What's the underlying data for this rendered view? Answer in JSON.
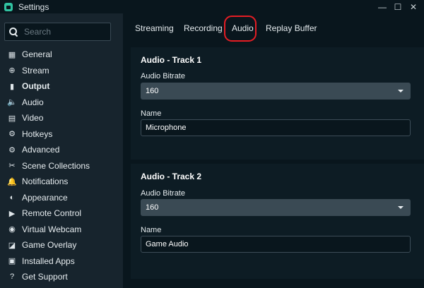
{
  "window": {
    "title": "Settings",
    "minimize": "—",
    "maximize": "☐",
    "close": "✕"
  },
  "search": {
    "placeholder": "Search",
    "value": ""
  },
  "sidebar": {
    "items": [
      {
        "label": "General",
        "icon": "grid-icon",
        "glyph": "▦"
      },
      {
        "label": "Stream",
        "icon": "globe-icon",
        "glyph": "⊕"
      },
      {
        "label": "Output",
        "icon": "output-icon",
        "glyph": "▮",
        "active": true
      },
      {
        "label": "Audio",
        "icon": "speaker-icon",
        "glyph": "🔈"
      },
      {
        "label": "Video",
        "icon": "film-icon",
        "glyph": "▤"
      },
      {
        "label": "Hotkeys",
        "icon": "gear-icon",
        "glyph": "⚙"
      },
      {
        "label": "Advanced",
        "icon": "gears-icon",
        "glyph": "⚙"
      },
      {
        "label": "Scene Collections",
        "icon": "tools-icon",
        "glyph": "✂"
      },
      {
        "label": "Notifications",
        "icon": "bell-icon",
        "glyph": "🔔"
      },
      {
        "label": "Appearance",
        "icon": "palette-icon",
        "glyph": "◐"
      },
      {
        "label": "Remote Control",
        "icon": "play-circle-icon",
        "glyph": "▶"
      },
      {
        "label": "Virtual Webcam",
        "icon": "camera-icon",
        "glyph": "◉"
      },
      {
        "label": "Game Overlay",
        "icon": "overlay-icon",
        "glyph": "◪"
      },
      {
        "label": "Installed Apps",
        "icon": "apps-icon",
        "glyph": "▣"
      },
      {
        "label": "Get Support",
        "icon": "help-icon",
        "glyph": "?"
      }
    ]
  },
  "tabs": [
    {
      "label": "Streaming"
    },
    {
      "label": "Recording"
    },
    {
      "label": "Audio",
      "active": true
    },
    {
      "label": "Replay Buffer"
    }
  ],
  "tracks": [
    {
      "title": "Audio - Track 1",
      "bitrate_label": "Audio Bitrate",
      "bitrate_value": "160",
      "name_label": "Name",
      "name_value": "Microphone"
    },
    {
      "title": "Audio - Track 2",
      "bitrate_label": "Audio Bitrate",
      "bitrate_value": "160",
      "name_label": "Name",
      "name_value": "Game Audio"
    }
  ],
  "colors": {
    "background": "#09161d",
    "sidebar": "#17242d",
    "card": "#0d1c24",
    "select": "#3a4a54",
    "highlight": "#e51d24",
    "accent": "#31c3a2"
  }
}
